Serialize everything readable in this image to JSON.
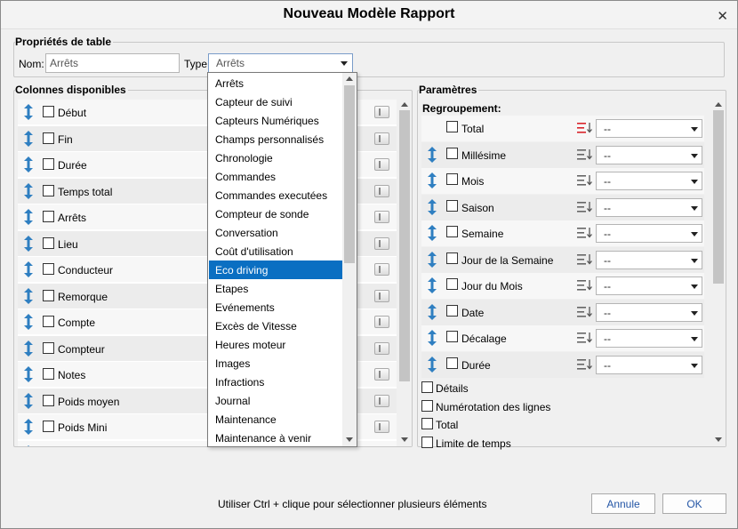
{
  "window": {
    "title": "Nouveau Modèle Rapport",
    "close_glyph": "✕"
  },
  "table_props": {
    "legend": "Propriétés de table",
    "name_label": "Nom:",
    "name_value": "Arrêts",
    "type_label": "Type:",
    "type_value": "Arrêts"
  },
  "columns": {
    "legend": "Colonnes disponibles",
    "items": [
      "Début",
      "Fin",
      "Durée",
      "Temps total",
      "Arrêts",
      "Lieu",
      "Conducteur",
      "Remorque",
      "Compte",
      "Compteur",
      "Notes",
      "Poids moyen",
      "Poids Mini"
    ]
  },
  "type_dropdown": {
    "selected_index": 10,
    "options": [
      "Arrêts",
      "Capteur de suivi",
      "Capteurs Numériques",
      "Champs personnalisés",
      "Chronologie",
      "Commandes",
      "Commandes executées",
      "Compteur de sonde",
      "Conversation",
      "Coût d'utilisation",
      "Eco driving",
      "Etapes",
      "Evénements",
      "Excès de Vitesse",
      "Heures moteur",
      "Images",
      "Infractions",
      "Journal",
      "Maintenance",
      "Maintenance à venir"
    ]
  },
  "params": {
    "legend": "Paramètres",
    "grouping_label": "Regroupement:",
    "groups": [
      {
        "label": "Total",
        "value": "--"
      },
      {
        "label": "Millésime",
        "value": "--"
      },
      {
        "label": "Mois",
        "value": "--"
      },
      {
        "label": "Saison",
        "value": "--"
      },
      {
        "label": "Semaine",
        "value": "--"
      },
      {
        "label": "Jour de la Semaine",
        "value": "--"
      },
      {
        "label": "Jour du Mois",
        "value": "--"
      },
      {
        "label": "Date",
        "value": "--"
      },
      {
        "label": "Décalage",
        "value": "--"
      },
      {
        "label": "Durée",
        "value": "--"
      }
    ],
    "checkboxes": [
      "Détails",
      "Numérotation des lignes",
      "Total",
      "Limite de temps"
    ]
  },
  "footer": {
    "hint": "Utiliser Ctrl + clique pour sélectionner plusieurs éléments",
    "cancel_label": "Annule",
    "ok_label": "OK"
  },
  "colors": {
    "accent": "#0a6fc2",
    "drag_icon": "#2f7fc1",
    "sort_active": "#d9242b"
  }
}
